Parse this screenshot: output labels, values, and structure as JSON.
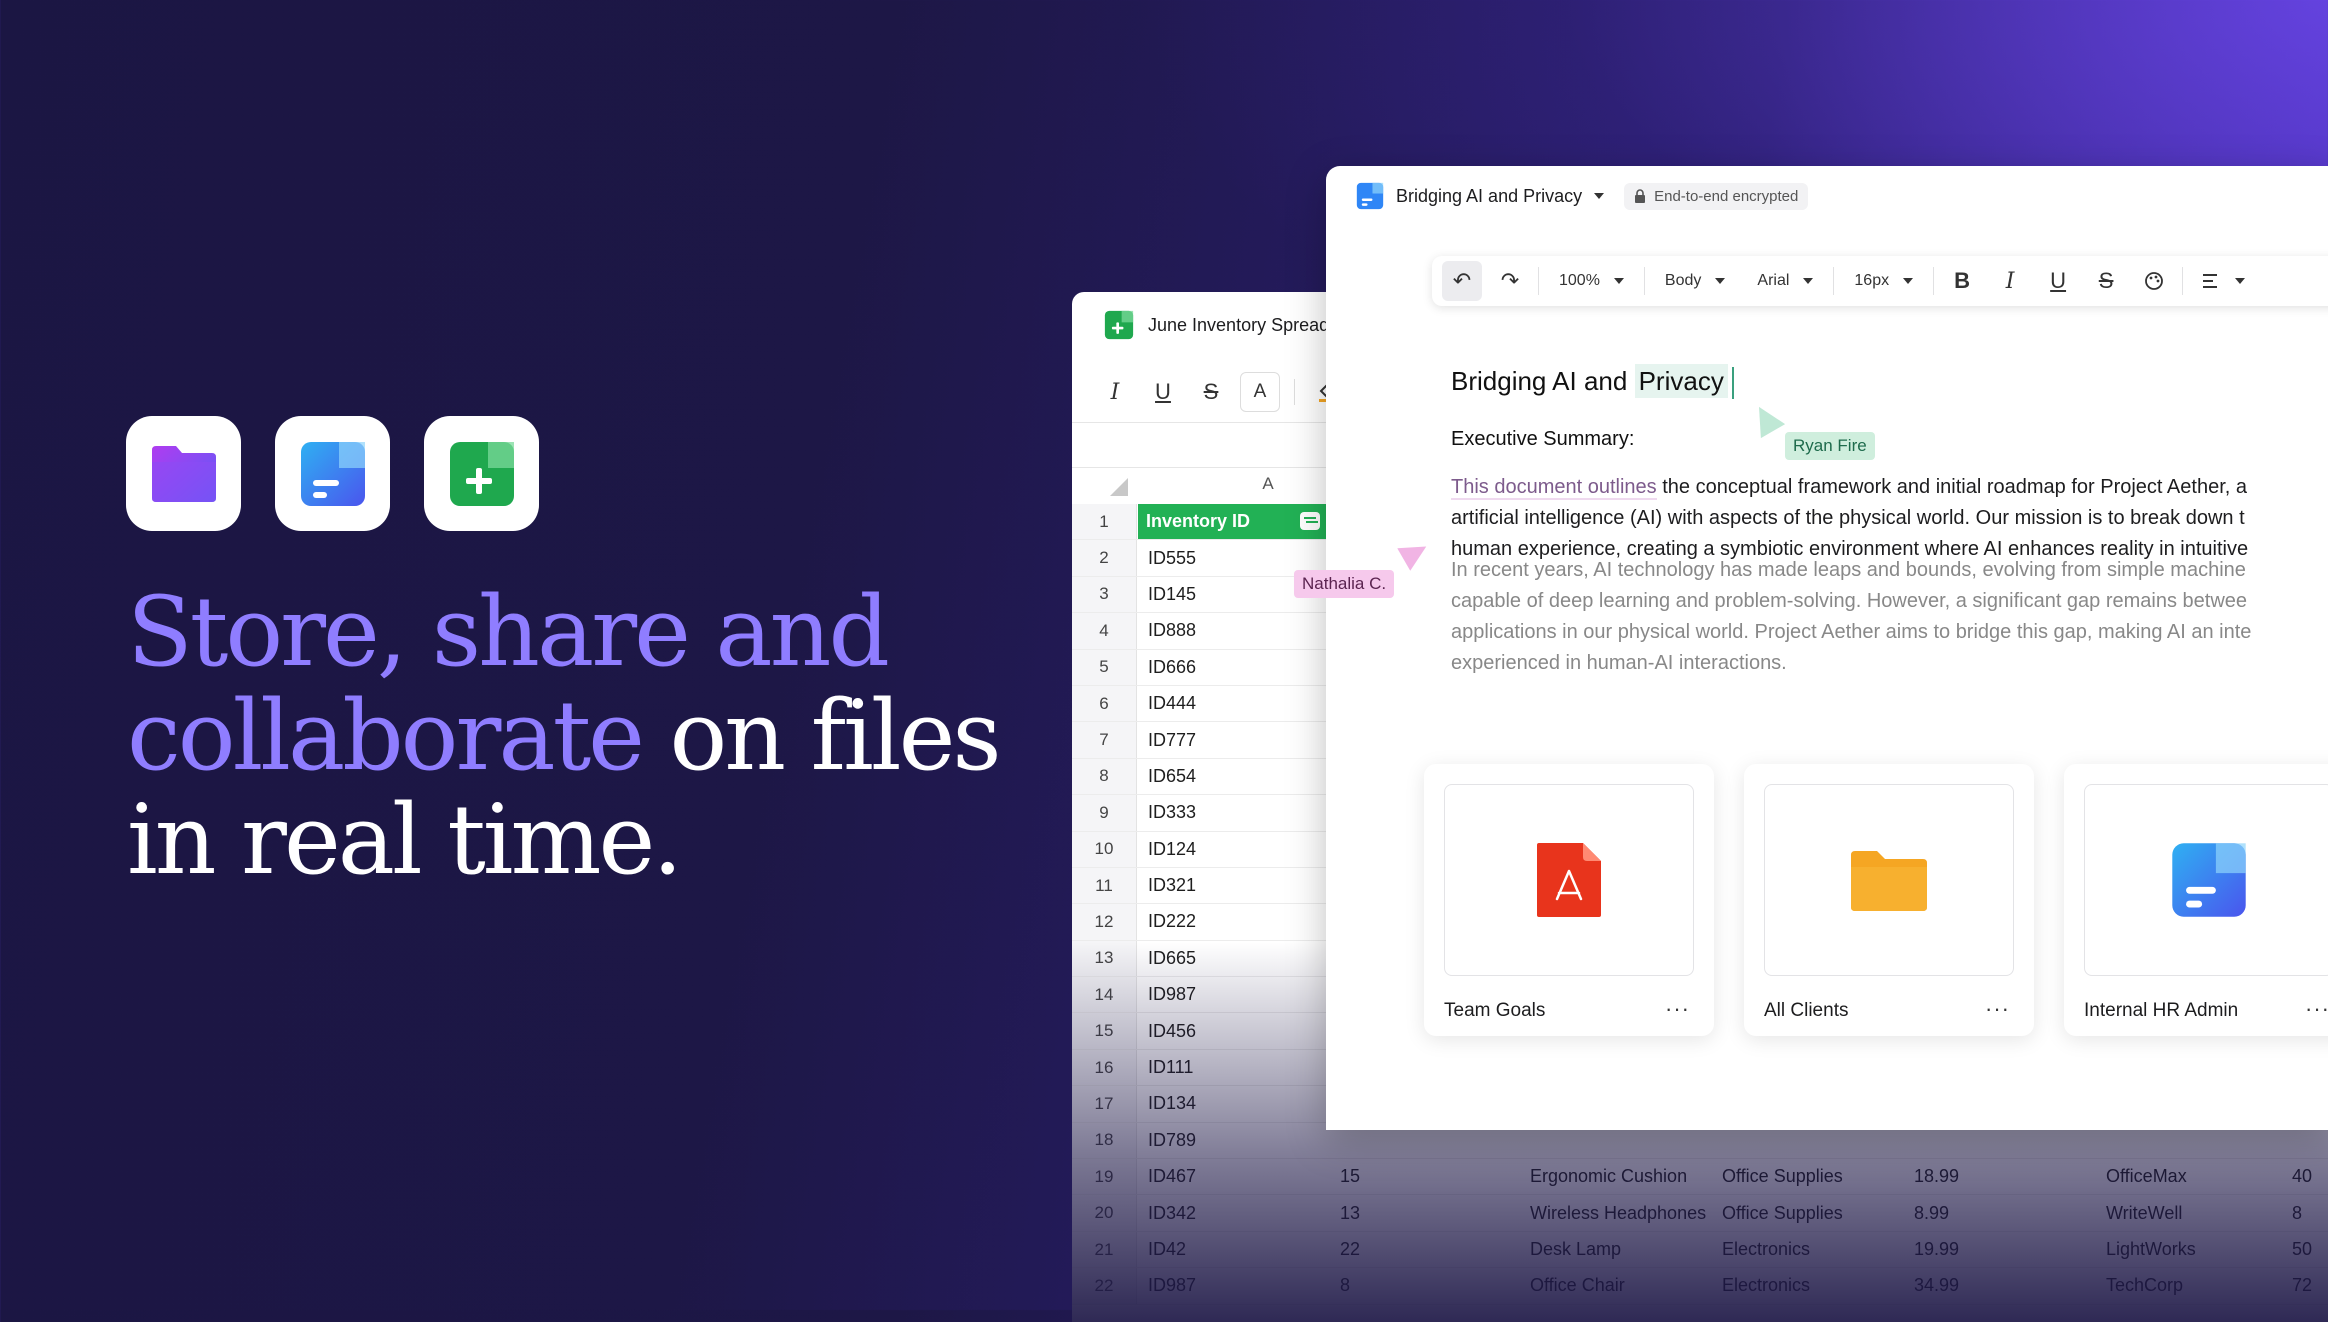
{
  "headline": {
    "accent": "Store, share and collaborate",
    "rest1": " on files",
    "rest2": "in real time."
  },
  "apps": [
    {
      "name": "Drive",
      "icon": "folder-app-icon"
    },
    {
      "name": "Docs",
      "icon": "docs-app-icon"
    },
    {
      "name": "Sheets",
      "icon": "sheets-app-icon"
    }
  ],
  "spreadsheet": {
    "title": "June Inventory Spreadsheet",
    "column_a": "A",
    "header": "Inventory ID",
    "rows": [
      {
        "n": "1",
        "a": "Inventory ID"
      },
      {
        "n": "2",
        "a": "ID555"
      },
      {
        "n": "3",
        "a": "ID145"
      },
      {
        "n": "4",
        "a": "ID888"
      },
      {
        "n": "5",
        "a": "ID666"
      },
      {
        "n": "6",
        "a": "ID444"
      },
      {
        "n": "7",
        "a": "ID777"
      },
      {
        "n": "8",
        "a": "ID654"
      },
      {
        "n": "9",
        "a": "ID333"
      },
      {
        "n": "10",
        "a": "ID124"
      },
      {
        "n": "11",
        "a": "ID321"
      },
      {
        "n": "12",
        "a": "ID222"
      },
      {
        "n": "13",
        "a": "ID665"
      },
      {
        "n": "14",
        "a": "ID987"
      },
      {
        "n": "15",
        "a": "ID456"
      },
      {
        "n": "16",
        "a": "ID111"
      },
      {
        "n": "17",
        "a": "ID134"
      },
      {
        "n": "18",
        "a": "ID789"
      },
      {
        "n": "19",
        "a": "ID467",
        "b": "15",
        "c": "Ergonomic Cushion",
        "d": "Office Supplies",
        "e": "18.99",
        "f": "OfficeMax",
        "g": "40"
      },
      {
        "n": "20",
        "a": "ID342",
        "b": "13",
        "c": "Wireless Headphones",
        "d": "Office Supplies",
        "e": "8.99",
        "f": "WriteWell",
        "g": "8"
      },
      {
        "n": "21",
        "a": "ID42",
        "b": "22",
        "c": "Desk Lamp",
        "d": "Electronics",
        "e": "19.99",
        "f": "LightWorks",
        "g": "50"
      },
      {
        "n": "22",
        "a": "ID987",
        "b": "8",
        "c": "Office Chair",
        "d": "Electronics",
        "e": "34.99",
        "f": "TechCorp",
        "g": "72"
      }
    ]
  },
  "document": {
    "title": "Bridging AI and Privacy",
    "encryption": "End-to-end encrypted",
    "toolbar": {
      "zoom": "100%",
      "style": "Body",
      "font": "Arial",
      "size": "16px"
    },
    "heading_pre": "Bridging AI and ",
    "heading_hl": "Privacy",
    "subheading": "Executive Summary:",
    "para1": [
      {
        "mark": "This document outlines",
        "rest": " the conceptual framework and initial roadmap for Project Aether, a"
      },
      {
        "mark": "",
        "rest": "artificial intelligence (AI) with aspects of the physical world. Our mission is to break down t"
      },
      {
        "mark": "",
        "rest": "human experience, creating a symbiotic environment where AI enhances reality in intuitive"
      }
    ],
    "para2": [
      "In recent years, AI technology has made leaps and bounds, evolving from simple machine",
      "capable of deep learning and problem-solving. However, a significant gap remains betwee",
      "applications in our physical world. Project Aether aims to bridge this gap, making AI an inte",
      "experienced in human-AI interactions."
    ],
    "cards": [
      {
        "label": "Team Goals",
        "type": "pdf"
      },
      {
        "label": "All Clients",
        "type": "folder"
      },
      {
        "label": "Internal HR Admin",
        "type": "doc"
      }
    ]
  },
  "collaborators": {
    "ryan": "Ryan Fire",
    "nathalia": "Nathalia C."
  },
  "colors": {
    "accent": "#8f7dff",
    "sheet_green": "#22b155",
    "pdf_red": "#e8341c",
    "folder_yellow": "#f5a623",
    "doc_blue": "#2f86f6"
  }
}
